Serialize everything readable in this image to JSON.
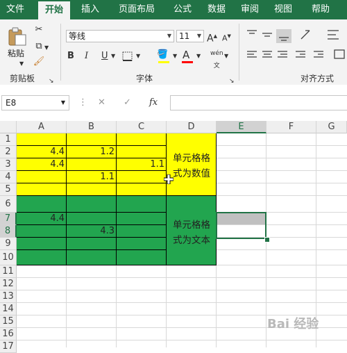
{
  "ribbon_tabs": [
    "文件",
    "开始",
    "插入",
    "页面布局",
    "公式",
    "数据",
    "审阅",
    "视图",
    "帮助"
  ],
  "active_tab": "开始",
  "clipboard": {
    "paste_label": "粘贴",
    "group_label": "剪贴板"
  },
  "font": {
    "name": "等线",
    "size": "11",
    "group_label": "字体",
    "bold": "B",
    "italic": "I",
    "underline": "U",
    "grow": "A",
    "shrink": "A",
    "fill_icon": "paint-bucket-icon",
    "font_color_icon": "font-color-icon",
    "phonetic": "wén",
    "fill_color": "#ffff00",
    "font_color": "#ff0000"
  },
  "alignment": {
    "group_label": "对齐方式"
  },
  "name_box": "E8",
  "formula_buttons": {
    "cancel": "✕",
    "enter": "✓",
    "fx": "fx"
  },
  "formula": "",
  "columns": [
    "A",
    "B",
    "C",
    "D",
    "E",
    "F",
    "G"
  ],
  "rows": [
    "1",
    "2",
    "3",
    "4",
    "5",
    "6",
    "7",
    "8",
    "9",
    "10",
    "11",
    "12",
    "13",
    "14",
    "15",
    "16",
    "17"
  ],
  "selected_column": "E",
  "selected_rows": [
    "7",
    "8"
  ],
  "cells": {
    "A2": "4.4",
    "B2": "1.2",
    "A3": "4.4",
    "C3": "1.1",
    "B4": "1.1",
    "A7": "4.4",
    "B8": "4.3"
  },
  "notes": {
    "number_block": "单元格格式为数值",
    "text_block": "单元格格式为文本"
  },
  "colors": {
    "excel_green": "#217346",
    "yellow_fill": "#ffff00",
    "green_fill": "#22a54f"
  },
  "watermark": "Bai 经验"
}
